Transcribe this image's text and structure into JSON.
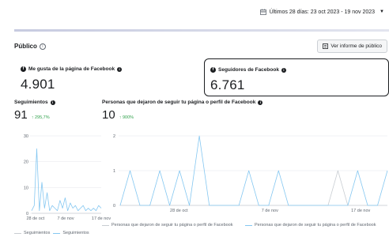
{
  "header": {
    "date_range": "Últimos 28 días: 23 oct 2023 - 19 nov 2023"
  },
  "section": {
    "title": "Público",
    "report_button": "Ver informe de público"
  },
  "cards": [
    {
      "label": "Me gusta de la página de Facebook",
      "value": "4.901"
    },
    {
      "label": "Seguidores de Facebook",
      "value": "6.761"
    }
  ],
  "metrics": [
    {
      "label": "Seguimientos",
      "value": "91",
      "delta": "295,7%"
    },
    {
      "label": "Personas que dejaron de seguir tu página o perfil de Facebook",
      "value": "10",
      "delta": "900%"
    }
  ],
  "colors": {
    "series_primary": "#84c7f1",
    "series_grey": "#c8cdd2",
    "delta_positive": "#31a24c",
    "accent": "#1c1e21"
  },
  "chart_data": [
    {
      "type": "line",
      "title": "Seguimientos",
      "x_ticks": [
        "28 de oct",
        "7 de nov",
        "17 de nov"
      ],
      "y_ticks": [
        0,
        10,
        20,
        30
      ],
      "ylim": [
        0,
        30
      ],
      "x": [
        "23 oct",
        "24 oct",
        "25 oct",
        "26 oct",
        "27 oct",
        "28 oct",
        "29 oct",
        "30 oct",
        "31 oct",
        "1 nov",
        "2 nov",
        "3 nov",
        "4 nov",
        "5 nov",
        "6 nov",
        "7 nov",
        "8 nov",
        "9 nov",
        "10 nov",
        "11 nov",
        "12 nov",
        "13 nov",
        "14 nov",
        "15 nov",
        "16 nov",
        "17 nov",
        "18 nov",
        "19 nov"
      ],
      "series": [
        {
          "name": "Seguimientos",
          "color": "#c8cdd2",
          "values": [
            0,
            0,
            0,
            0,
            0,
            0,
            0,
            0,
            0,
            0,
            0,
            0,
            0,
            0,
            0,
            0,
            0,
            0,
            0,
            0,
            0,
            0,
            0,
            0,
            0,
            0,
            0,
            0
          ]
        },
        {
          "name": "Seguimientos",
          "color": "#84c7f1",
          "values": [
            1,
            3,
            25,
            1,
            12,
            2,
            8,
            1,
            3,
            2,
            1,
            5,
            2,
            6,
            1,
            4,
            2,
            3,
            1,
            2,
            3,
            1,
            2,
            1,
            2,
            1,
            3,
            2
          ]
        }
      ],
      "legend": [
        "Seguimientos",
        "Seguimientos"
      ]
    },
    {
      "type": "line",
      "title": "Personas que dejaron de seguir tu página o perfil de Facebook",
      "x_ticks": [
        "28 de oct",
        "7 de nov",
        "17 de nov"
      ],
      "y_ticks": [
        0,
        1,
        2
      ],
      "ylim": [
        0,
        2
      ],
      "x": [
        "23 oct",
        "24 oct",
        "25 oct",
        "26 oct",
        "27 oct",
        "28 oct",
        "29 oct",
        "30 oct",
        "31 oct",
        "1 nov",
        "2 nov",
        "3 nov",
        "4 nov",
        "5 nov",
        "6 nov",
        "7 nov",
        "8 nov",
        "9 nov",
        "10 nov",
        "11 nov",
        "12 nov",
        "13 nov",
        "14 nov",
        "15 nov",
        "16 nov",
        "17 nov",
        "18 nov",
        "19 nov"
      ],
      "series": [
        {
          "name": "Personas que dejaron de seguir tu página o perfil de Facebook",
          "color": "#c8cdd2",
          "values": [
            0,
            0,
            0,
            0,
            0,
            0,
            0,
            0,
            0,
            0,
            0,
            0,
            0,
            0,
            0,
            0,
            0,
            0,
            0,
            0,
            0,
            0,
            1,
            0,
            0,
            0,
            0,
            0
          ]
        },
        {
          "name": "Personas que dejaron de seguir tu página o perfil de Facebook",
          "color": "#84c7f1",
          "values": [
            0,
            1,
            0,
            0,
            1,
            0,
            1,
            0,
            2,
            0,
            0,
            0,
            0,
            1,
            0,
            0,
            1,
            0,
            0,
            0,
            0,
            0,
            0,
            0,
            1,
            0,
            0,
            1
          ]
        }
      ],
      "legend": [
        "Personas que dejaron de seguir tu página o perfil de Facebook",
        "Personas que dejaron de seguir tu página o perfil de Facebook"
      ]
    }
  ]
}
